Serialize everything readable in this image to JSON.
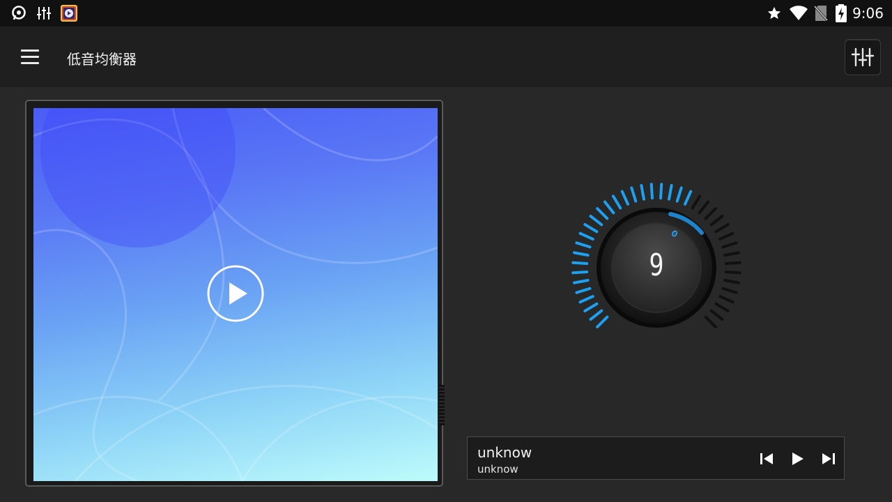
{
  "status_bar": {
    "time": "9:06",
    "left_icons": [
      "app-pin-icon",
      "equalizer-notification-icon",
      "video-player-app-icon"
    ],
    "right_icons": [
      "star-icon",
      "wifi-icon",
      "no-sim-icon",
      "battery-charging-icon"
    ]
  },
  "app_bar": {
    "title": "低音均衡器",
    "menu_icon": "hamburger-menu-icon",
    "action_icon": "equalizer-sliders-icon"
  },
  "album_art": {
    "play_icon": "play-circle-icon"
  },
  "bass_knob": {
    "value": "9",
    "active_ticks": 24,
    "total_ticks": 40,
    "accent_color": "#1ea0f0"
  },
  "player": {
    "title": "unknow",
    "artist": "unknow",
    "controls": [
      "previous-icon",
      "play-icon",
      "next-icon"
    ]
  }
}
